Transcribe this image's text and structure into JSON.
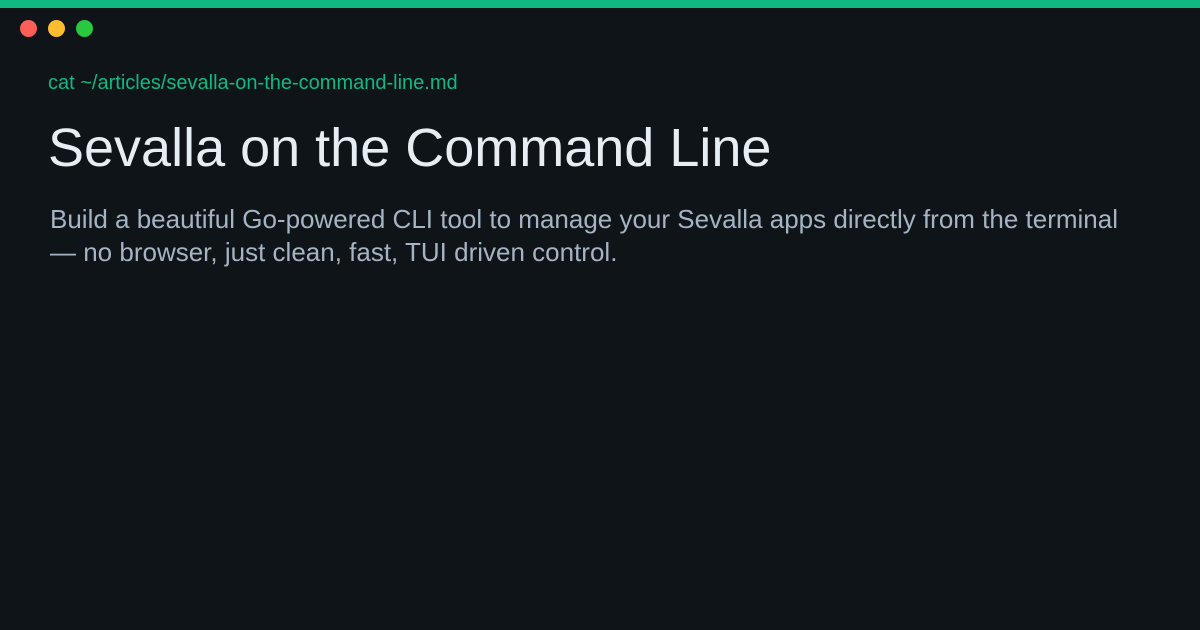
{
  "window": {
    "controls": [
      "close",
      "minimize",
      "maximize"
    ]
  },
  "colors": {
    "accent": "#10b981",
    "background": "#0f1419",
    "title": "#e6edf3",
    "description": "#a5b4c3",
    "close": "#ff5f57",
    "minimize": "#febc2e",
    "maximize": "#28c840"
  },
  "terminal": {
    "command": "cat ~/articles/sevalla-on-the-command-line.md"
  },
  "article": {
    "title": "Sevalla on the Command Line",
    "description": "Build a beautiful Go-powered CLI tool to manage your Sevalla apps directly from the terminal — no browser, just clean, fast, TUI driven control."
  }
}
